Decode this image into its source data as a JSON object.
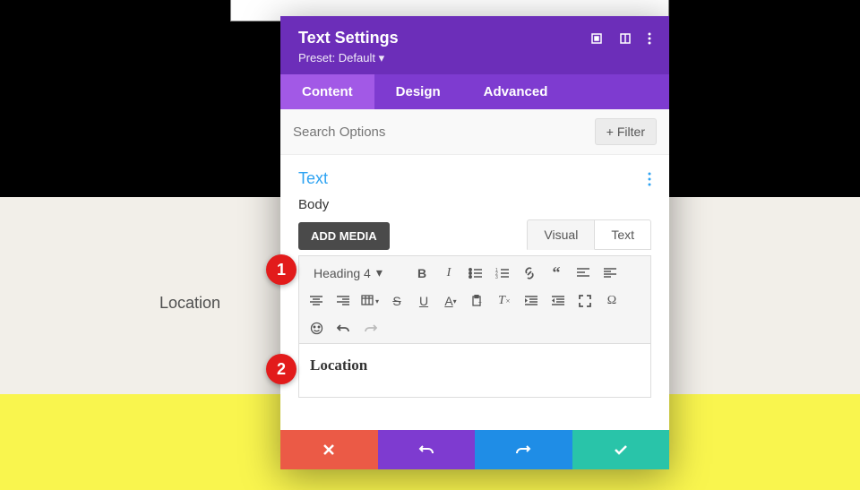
{
  "page": {
    "location_label": "Location"
  },
  "panel": {
    "title": "Text Settings",
    "preset": "Preset: Default",
    "tabs": [
      "Content",
      "Design",
      "Advanced"
    ],
    "active_tab": 0,
    "search_placeholder": "Search Options",
    "filter_label": "Filter",
    "section_title": "Text",
    "body_label": "Body",
    "add_media_label": "ADD MEDIA",
    "editor_tabs": [
      "Visual",
      "Text"
    ],
    "editor_active_tab": 0,
    "format_label": "Heading 4",
    "editor_content": "Location"
  },
  "callouts": {
    "one": "1",
    "two": "2"
  },
  "colors": {
    "purple_dark": "#6c2eb9",
    "purple": "#7e3bd0",
    "purple_light": "#a259e6",
    "blue": "#1f8de6",
    "green": "#29c4a9",
    "red": "#eb5a46"
  }
}
